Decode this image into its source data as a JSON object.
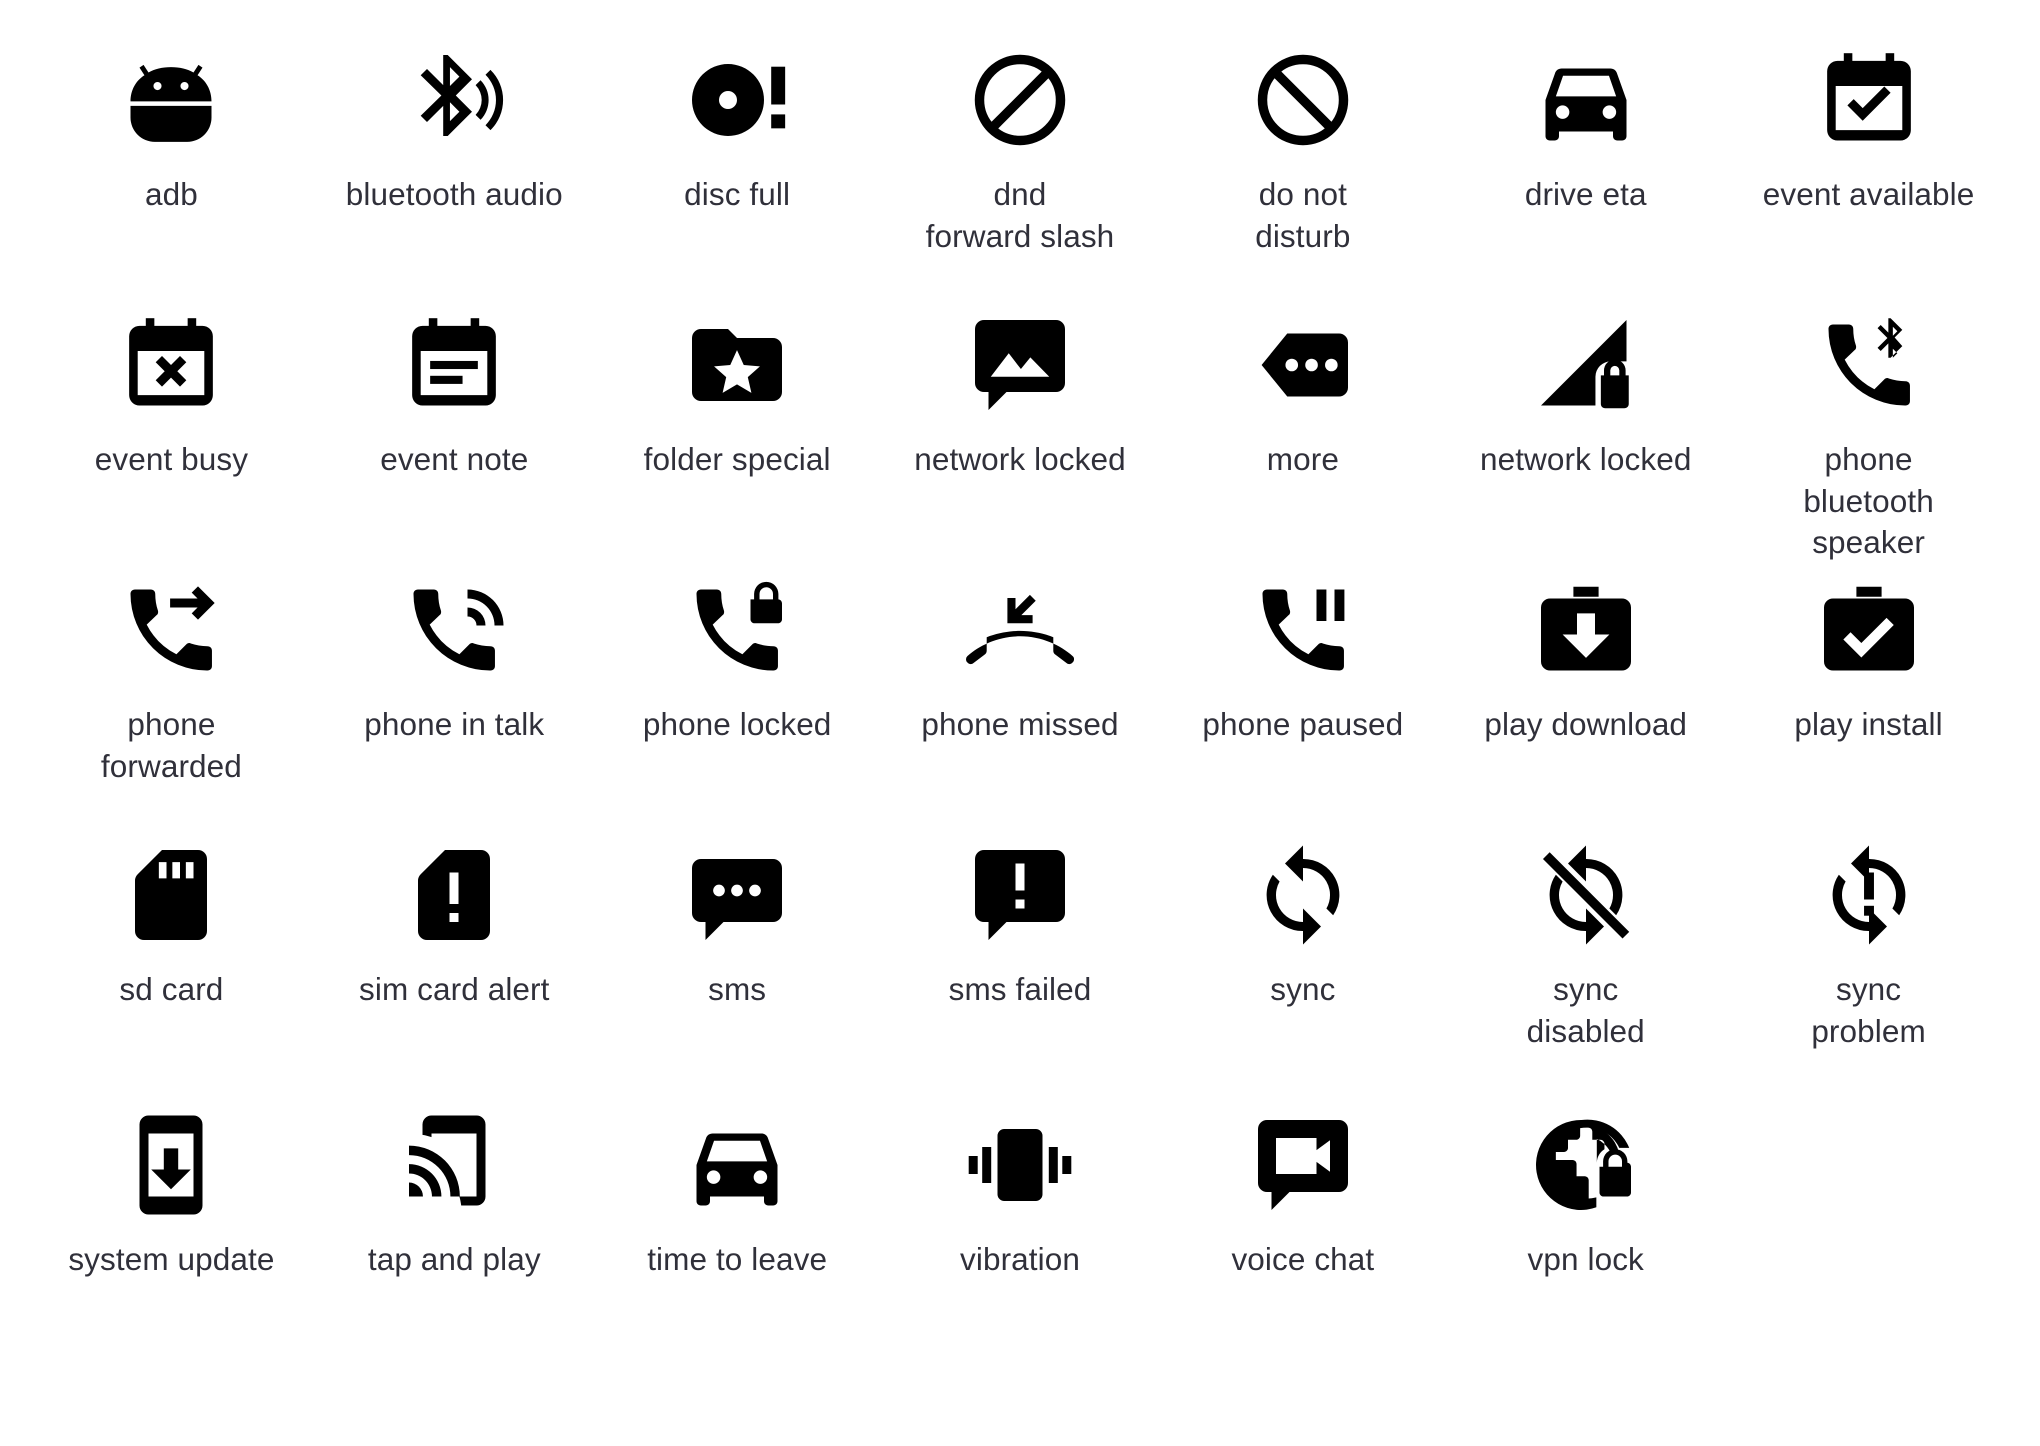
{
  "sheet": {
    "background_color": "#ffffff",
    "icon_color": "#000000",
    "label_color": "#30303a",
    "columns": 7,
    "rows": 5,
    "total_icons": 34
  },
  "rows": [
    {
      "icons": [
        {
          "label": "adb",
          "icon": "adb-icon"
        },
        {
          "label": "bluetooth audio",
          "icon": "bluetooth-audio-icon"
        },
        {
          "label": "disc full",
          "icon": "disc-full-icon"
        },
        {
          "label": "dnd\nforward slash",
          "icon": "dnd-forward-slash-icon"
        },
        {
          "label": "do not\ndisturb",
          "icon": "do-not-disturb-icon"
        },
        {
          "label": "drive eta",
          "icon": "drive-eta-icon"
        },
        {
          "label": "event available",
          "icon": "event-available-icon"
        }
      ]
    },
    {
      "icons": [
        {
          "label": "event busy",
          "icon": "event-busy-icon"
        },
        {
          "label": "event note",
          "icon": "event-note-icon"
        },
        {
          "label": "folder special",
          "icon": "folder-special-icon"
        },
        {
          "label": "network locked",
          "icon": "network-locked-chat-icon"
        },
        {
          "label": "more",
          "icon": "more-icon"
        },
        {
          "label": "network locked",
          "icon": "network-locked-signal-icon"
        },
        {
          "label": "phone\nbluetooth\nspeaker",
          "icon": "phone-bluetooth-speaker-icon"
        }
      ]
    },
    {
      "icons": [
        {
          "label": "phone\nforwarded",
          "icon": "phone-forwarded-icon"
        },
        {
          "label": "phone in talk",
          "icon": "phone-in-talk-icon"
        },
        {
          "label": "phone locked",
          "icon": "phone-locked-icon"
        },
        {
          "label": "phone missed",
          "icon": "phone-missed-icon"
        },
        {
          "label": "phone paused",
          "icon": "phone-paused-icon"
        },
        {
          "label": "play download",
          "icon": "play-download-icon"
        },
        {
          "label": "play install",
          "icon": "play-install-icon"
        }
      ]
    },
    {
      "icons": [
        {
          "label": "sd card",
          "icon": "sd-card-icon"
        },
        {
          "label": "sim card alert",
          "icon": "sim-card-alert-icon"
        },
        {
          "label": "sms",
          "icon": "sms-icon"
        },
        {
          "label": "sms failed",
          "icon": "sms-failed-icon"
        },
        {
          "label": "sync",
          "icon": "sync-icon"
        },
        {
          "label": "sync\ndisabled",
          "icon": "sync-disabled-icon"
        },
        {
          "label": "sync\nproblem",
          "icon": "sync-problem-icon"
        }
      ]
    },
    {
      "icons": [
        {
          "label": "system update",
          "icon": "system-update-icon"
        },
        {
          "label": "tap and play",
          "icon": "tap-and-play-icon"
        },
        {
          "label": "time to leave",
          "icon": "time-to-leave-icon"
        },
        {
          "label": "vibration",
          "icon": "vibration-icon"
        },
        {
          "label": "voice chat",
          "icon": "voice-chat-icon"
        },
        {
          "label": "vpn lock",
          "icon": "vpn-lock-icon"
        }
      ]
    }
  ]
}
